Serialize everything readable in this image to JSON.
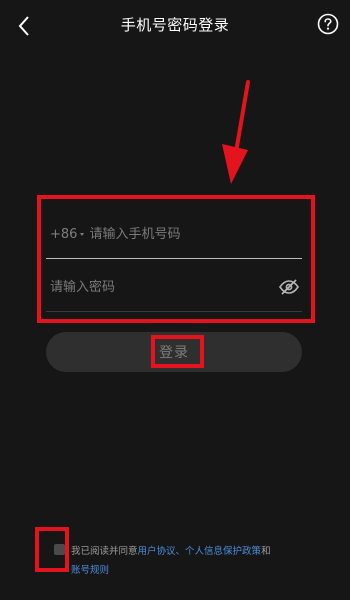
{
  "header": {
    "title": "手机号密码登录",
    "back_icon": "back-chevron-icon",
    "help_icon": "question-circle-icon"
  },
  "form": {
    "country_code": "+86",
    "phone_placeholder": "请输入手机号码",
    "password_placeholder": "请输入密码",
    "visibility_icon": "eye-off-icon"
  },
  "login_button": {
    "label": "登录"
  },
  "agreement": {
    "prefix": "我已阅读并同意",
    "user_agreement": "用户协议",
    "separator": "、",
    "privacy_policy": "个人信息保护政策",
    "conjunction": "和",
    "account_rules": "账号规则",
    "checked": false
  },
  "colors": {
    "background": "#161616",
    "link": "#4d8de0",
    "annotation": "#e3141d",
    "button_bg": "#2f2f2f"
  }
}
